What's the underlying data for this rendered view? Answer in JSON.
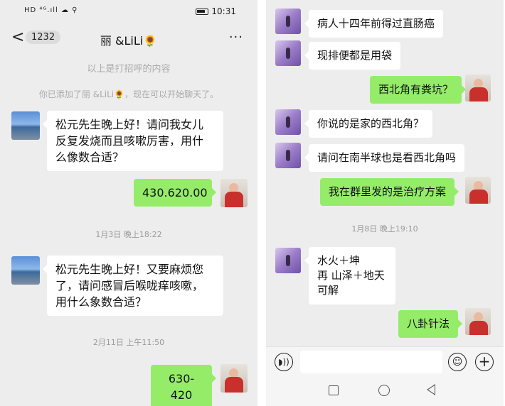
{
  "left": {
    "status": {
      "signals": "HD ⁴ᴳ.ıll ☁ ⚲",
      "time": "10:31"
    },
    "header": {
      "back": "<",
      "count": "1232",
      "title": "丽 &LiLi🌻",
      "more": "···"
    },
    "system": {
      "greeting_note": "以上是打招呼的内容",
      "added_note": "你已添加了丽 &LiLi🌻，现在可以开始聊天了。"
    },
    "messages": {
      "m1": "松元先生晚上好！请问我女儿\n反复发烧而且咳嗽厉害，用什\n么像数合适？",
      "m2": "430.620.00",
      "t1": "1月3日 晚上18:22",
      "m3": "松元先生晚上好！又要麻烦您\n了，请问感冒后喉咙痒咳嗽，\n用什么象数合适？",
      "t2": "2月11日 上午11:50",
      "m4": "630-420"
    }
  },
  "right": {
    "messages": {
      "r1": "病人十四年前得过直肠癌",
      "r2": "现排便都是用袋",
      "r3": "西北角有粪坑？",
      "r4": "你说的是家的西北角？",
      "r5": "请问在南半球也是看西北角吗",
      "r6": "我在群里发的是治疗方案",
      "t1": "1月8日 晚上19:10",
      "r7": "水火＋坤\n再  山泽＋地天\n可解",
      "r8": "八卦针法"
    },
    "inputbar": {
      "voice_icon": "voice-icon",
      "emoji_icon": "emoji-icon",
      "plus_icon": "plus-icon"
    },
    "navbar": {
      "icons": [
        "recent-apps-icon",
        "home-icon",
        "back-icon"
      ]
    }
  },
  "colors": {
    "sent_bubble": "#95ec69",
    "received_bubble": "#ffffff",
    "chat_background": "#ededed"
  }
}
